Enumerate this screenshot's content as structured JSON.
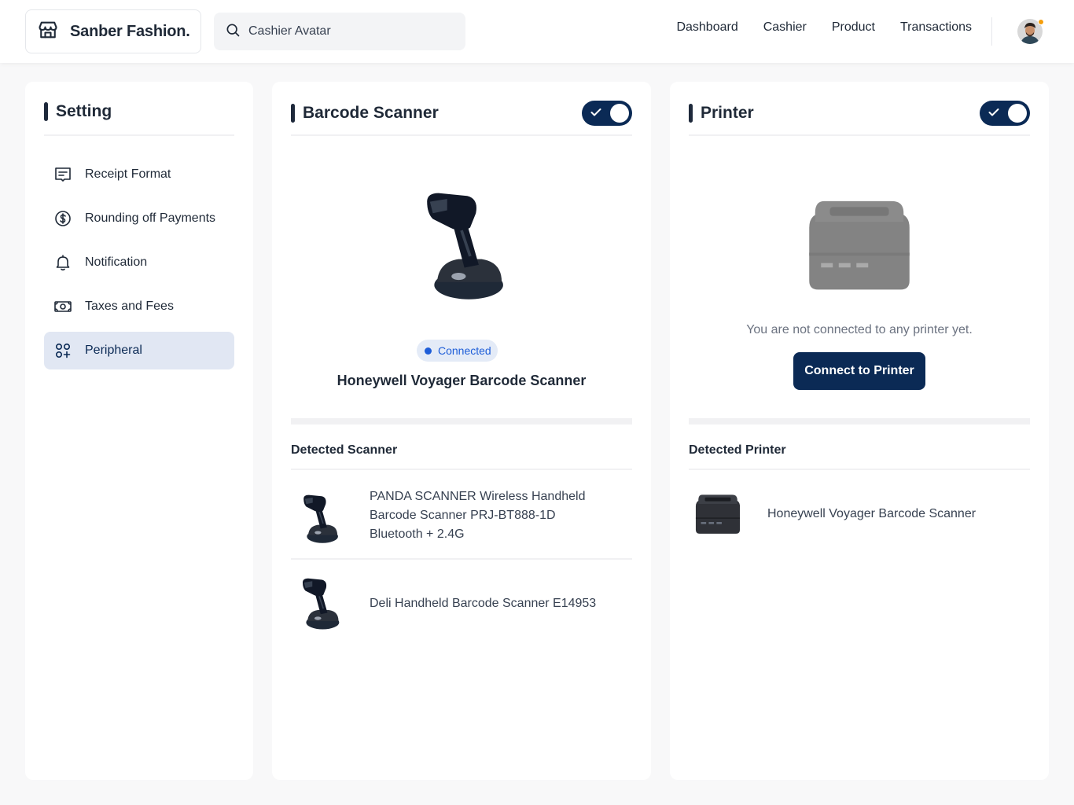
{
  "header": {
    "brand_name": "Sanber Fashion.",
    "search_value": "Cashier Avatar",
    "nav": [
      "Dashboard",
      "Cashier",
      "Product",
      "Transactions"
    ]
  },
  "settings": {
    "title": "Setting",
    "items": [
      {
        "label": "Receipt Format",
        "icon": "receipt-icon",
        "active": false
      },
      {
        "label": "Rounding off Payments",
        "icon": "dollar-circle-icon",
        "active": false
      },
      {
        "label": "Notification",
        "icon": "bell-icon",
        "active": false
      },
      {
        "label": "Taxes and Fees",
        "icon": "money-icon",
        "active": false
      },
      {
        "label": "Peripheral",
        "icon": "peripheral-icon",
        "active": true
      }
    ]
  },
  "scanner": {
    "title": "Barcode Scanner",
    "enabled": true,
    "status": "Connected",
    "device_name": "Honeywell Voyager Barcode Scanner",
    "detected_label": "Detected Scanner",
    "detected": [
      {
        "name": "PANDA SCANNER Wireless Handheld Barcode Scanner PRJ-BT888-1D Bluetooth + 2.4G"
      },
      {
        "name": "Deli Handheld Barcode Scanner E14953"
      }
    ]
  },
  "printer": {
    "title": "Printer",
    "enabled": true,
    "empty_message": "You are not connected to any printer yet.",
    "connect_label": "Connect to Printer",
    "detected_label": "Detected Printer",
    "detected": [
      {
        "name": "Honeywell Voyager Barcode Scanner"
      }
    ]
  },
  "colors": {
    "primary": "#0B2A55",
    "badge_bg": "#E4EBF7",
    "badge_text": "#1D5DD8",
    "active_bg": "#E1E7F3",
    "avatar_dot": "#F59E0B"
  }
}
